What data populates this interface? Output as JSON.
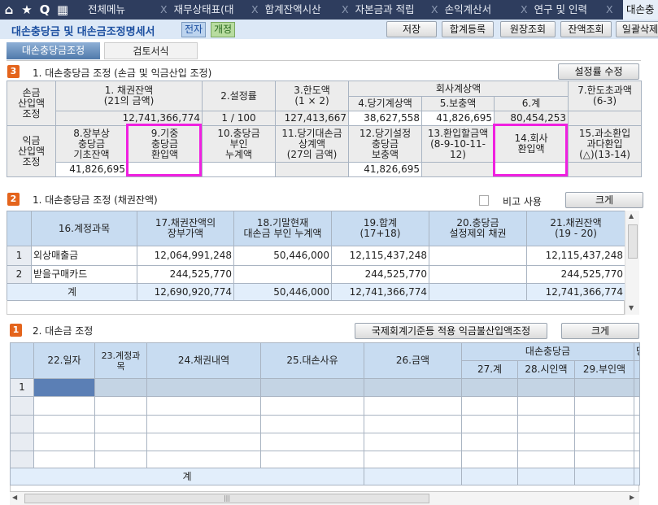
{
  "nav": {
    "menu_label": "전체메뉴",
    "tabs": [
      "재무상태표(대",
      "합계잔액시산",
      "자본금과 적립",
      "손익계산서",
      "연구 및 인력",
      "대손충"
    ]
  },
  "toolbar": {
    "title": "대손충당금 및 대손금조정명세서",
    "badge1": "전자",
    "badge2": "개정",
    "buttons": [
      "저장",
      "합계등록",
      "원장조회",
      "잔액조회",
      "일괄삭제"
    ]
  },
  "page_tabs": [
    "대손충당금조정",
    "검토서식"
  ],
  "section3": {
    "num": "3",
    "title": "1. 대손충당금 조정 (손금 및 익금산입 조정)",
    "button": "설정률 수정",
    "row_label1": "손금\n산입액\n조정",
    "row_label2": "익금\n산입액\n조정",
    "h1": "1. 채권잔액\n(21의 금액)",
    "h2": "2.설정률",
    "h3": "3.한도액\n(1 × 2)",
    "h_group": "회사계상액",
    "h4": "4.당기계상액",
    "h5": "5.보충액",
    "h6": "6.계",
    "h7": "7.한도초과액\n(6-3)",
    "v1": "12,741,366,774",
    "v2": "1 / 100",
    "v3": "127,413,667",
    "v4": "38,627,558",
    "v5": "41,826,695",
    "v6": "80,454,253",
    "h8": "8.장부상\n충당금\n기초잔액",
    "h9": "9.기중\n충당금\n환입액",
    "h10": "10.충당금\n부인\n누계액",
    "h11": "11.당기대손금\n상계액\n(27의 금액)",
    "h12": "12.당기설정\n충당금\n보충액",
    "h13": "13.환입할금액\n(8-9-10-11-12)",
    "h14": "14.회사\n환입액",
    "h15": "15.과소환입\n과다환입\n(△)(13-14)",
    "v8": "41,826,695",
    "v12": "41,826,695"
  },
  "section2": {
    "num": "2",
    "title": "1. 대손충당금 조정 (채권잔액)",
    "checkbox_label": "비고 사용",
    "button": "크게",
    "headers": [
      "16.계정과목",
      "17.채권잔액의\n장부가액",
      "18.기말현재\n대손금 부인 누계액",
      "19.합계\n(17+18)",
      "20.충당금\n설정제외 채권",
      "21.채권잔액\n(19 - 20)"
    ],
    "rows": [
      {
        "no": "1",
        "cells": [
          "외상매출금",
          "12,064,991,248",
          "50,446,000",
          "12,115,437,248",
          "",
          "12,115,437,248"
        ]
      },
      {
        "no": "2",
        "cells": [
          "받을구매카드",
          "244,525,770",
          "",
          "244,525,770",
          "",
          "244,525,770"
        ]
      }
    ],
    "total": {
      "label": "계",
      "cells": [
        "12,690,920,774",
        "50,446,000",
        "12,741,366,774",
        "",
        "12,741,366,774"
      ]
    }
  },
  "section1": {
    "num": "1",
    "title": "2. 대손금 조정",
    "button1": "국제회계기준등 적용 익금불산입액조정",
    "button2": "크게",
    "headers": {
      "h22": "22.일자",
      "h23": "23.계정과\n목",
      "h24": "24.채권내역",
      "h25": "25.대손사유",
      "h26": "26.금액",
      "group": "대손충당금",
      "h27": "27.계",
      "h28": "28.시인액",
      "h29": "29.부인액",
      "h_more": "당"
    },
    "row1_no": "1",
    "total_label": "계"
  }
}
